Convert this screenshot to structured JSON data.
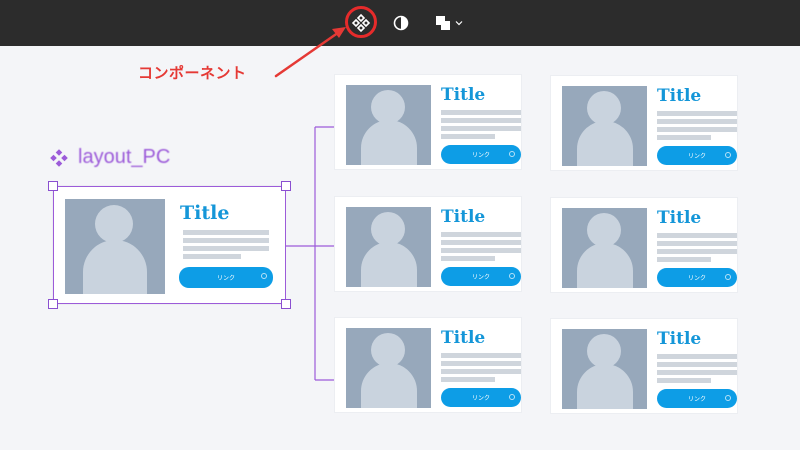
{
  "toolbar": {
    "icons": [
      "component-icon",
      "contrast-icon",
      "boolean-icon",
      "chevron-down-icon"
    ],
    "highlight_color": "#e62b2b"
  },
  "annotation": {
    "label": "コンポーネント",
    "color": "#e53935"
  },
  "component": {
    "name": "layout_PC",
    "color": "#9c5bd9"
  },
  "main_card": {
    "title": "Title",
    "button": "リンク"
  },
  "cards": [
    {
      "title": "Title",
      "button": "リンク"
    },
    {
      "title": "Title",
      "button": "リンク"
    },
    {
      "title": "Title",
      "button": "リンク"
    },
    {
      "title": "Title",
      "button": "リンク"
    },
    {
      "title": "Title",
      "button": "リンク"
    },
    {
      "title": "Title",
      "button": "リンク"
    }
  ],
  "colors": {
    "accent": "#0d9de6",
    "title": "#1496d8",
    "placeholder": "#97a8bb",
    "connector": "#9c5bd9"
  }
}
